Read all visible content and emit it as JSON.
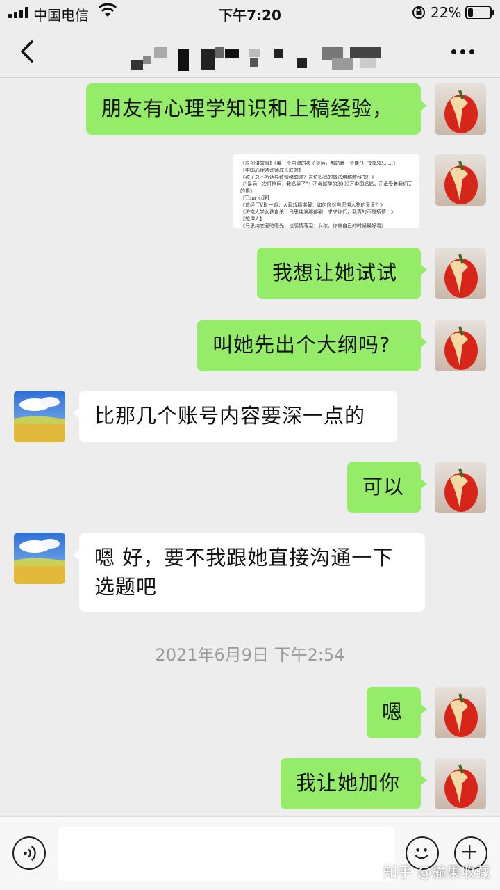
{
  "status_bar": {
    "carrier": "中国电信",
    "time": "下午7:20",
    "battery_percent": "22%",
    "battery_level": 0.22
  },
  "nav": {
    "title": "",
    "back_icon": "chevron-left-icon",
    "more_icon": "more-dots-icon"
  },
  "image_message": {
    "lines": [
      "【原创讲故事】《每一个自律的孩子背后，都站着一个能\"狂\"的妈妈……》",
      "【中国心理咨询师成长联盟】",
      "《孩子总不听话导致情绪崩溃？这位妈妈的做法堪称教科书！》",
      "《\"最后一次打枪后，我妈哭了\"：不会碱酸的3000万中国妈妈，正承受着我们无法想象的",
      "的累》",
      "【Tina 心理】",
      "《曾经 TVB 一姐，大观戏精湛藏：如何应对自您惧人物的爱爱？》",
      "《济南大学女孩自杀，马思纯演那部剧：求求你们，我真的不是矫情！》",
      "【想谭人】",
      "《马思纯恋爱暗曝光，谈感情落泪：女孩，你做自己的时候最好看》"
    ]
  },
  "messages": [
    {
      "sender": "me",
      "text": "朋友有心理学知识和上稿经验，"
    },
    {
      "sender": "me",
      "text": "我想让她试试"
    },
    {
      "sender": "me",
      "text": "叫她先出个大纲吗?"
    },
    {
      "sender": "other",
      "text": "比那几个账号内容要深一点的"
    },
    {
      "sender": "me",
      "text": "可以"
    },
    {
      "sender": "other",
      "text": "嗯 好，要不我跟她直接沟通一下选题吧"
    },
    {
      "sender": "me",
      "text": "嗯"
    },
    {
      "sender": "me",
      "text": "我让她加你"
    }
  ],
  "timestamp": "2021年6月9日 下午2:54",
  "input_bar": {
    "voice_icon": "voice-icon",
    "emoji_icon": "emoji-icon",
    "plus_icon": "plus-icon"
  },
  "watermark": "知乎 @榆果收藏"
}
